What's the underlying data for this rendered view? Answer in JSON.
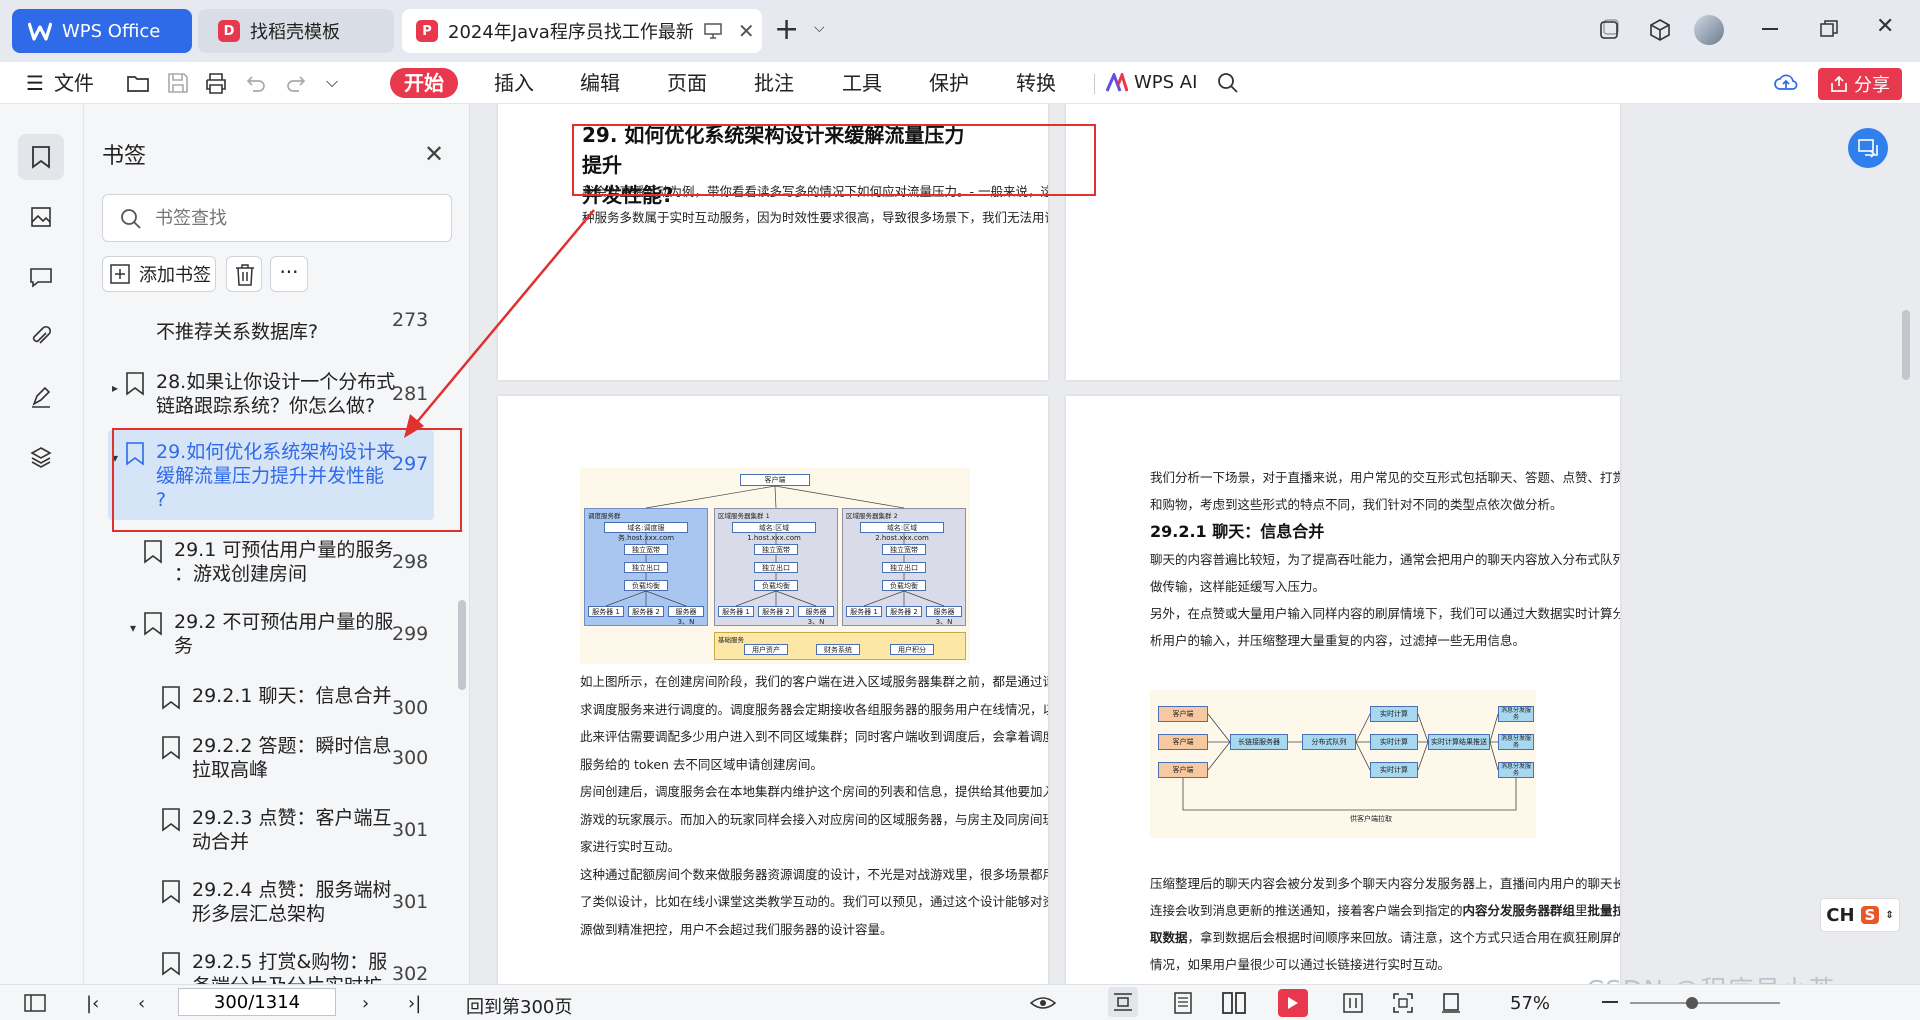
{
  "titlebar": {
    "app_tab": "WPS Office",
    "tabs": [
      {
        "label": "找稻壳模板"
      },
      {
        "label": "2024年Java程序员找工作最新"
      }
    ],
    "new_tab": "+"
  },
  "menubar": {
    "file": "文件",
    "items": [
      "开始",
      "插入",
      "编辑",
      "页面",
      "批注",
      "工具",
      "保护",
      "转换"
    ],
    "wps_ai": "WPS AI",
    "share": "分享"
  },
  "panel": {
    "title": "书签",
    "search_placeholder": "书签查找",
    "add_label": "添加书签",
    "more": "···",
    "items": [
      {
        "label": "不推荐关系数据库?",
        "page": "273"
      },
      {
        "label": "28.如果让你设计一个分布式\n链路跟踪系统？你怎么做?",
        "page": "281"
      },
      {
        "label": "29.如何优化系统架构设计来\n缓解流量压力提升并发性能\n?",
        "page": "297"
      },
      {
        "label": "29.1 可预估用户量的服务\n：游戏创建房间",
        "page": "298"
      },
      {
        "label": "29.2 不可预估用户量的服\n务",
        "page": "299"
      },
      {
        "label": "29.2.1 聊天：信息合并",
        "page": "300"
      },
      {
        "label": "29.2.2 答题：瞬时信息\n拉取高峰",
        "page": "300"
      },
      {
        "label": "29.2.3 点赞：客户端互\n动合并",
        "page": "301"
      },
      {
        "label": "29.2.4 点赞：服务端树\n形多层汇总架构",
        "page": "301"
      },
      {
        "label": "29.2.5 打赏&购物：服\n务端分片及分片实时扩",
        "page": "302"
      }
    ]
  },
  "document": {
    "heading_29": "29.  如何优化系统架构设计来缓解流量压力提升\n并发性能?",
    "p1_line1": "我会以直播互动为例，带你看看读多写多的情况下如何应对流量压力。- 一般来说，这",
    "p1_line2": "种服务多数属于实时互动服务，因为时效性要求很高，导致很多场景下，我们无法用读",
    "diagram_left": {
      "client": "客户端",
      "group1": "调度服务群",
      "group2": "区域服务器集群 1",
      "group3": "区域服务器集群 2",
      "domain1": "域名:调度服务.host.xxx.com",
      "domain2": "域名:区域1.host.xxx.com",
      "domain3": "域名:区域2.host.xxx.com",
      "ingress": "独立宽带",
      "egress": "独立出口",
      "lb": "负载均衡",
      "server1": "服务器 1",
      "server2": "服务器 2",
      "server3n": "服务器 3、N",
      "base": "基础服务",
      "users": "用户资产",
      "finance": "财务系统",
      "points": "用户积分"
    },
    "left_para": [
      "如上图所示，在创建房间阶段，我们的客户端在进入区域服务器集群之前，都是通过请",
      "求调度服务来进行调度的。调度服务器会定期接收各组服务器的服务用户在线情况，以",
      "此来评估需要调配多少用户进入到不同区域集群；同时客户端收到调度后，会拿着调度",
      "服务给的 token 去不同区域申请创建房间。",
      "房间创建后，调度服务会在本地集群内维护这个房间的列表和信息，提供给其他要加入",
      "游戏的玩家展示。而加入的玩家同样会接入对应房间的区域服务器，与房主及同房间玩",
      "家进行实时互动。",
      "这种通过配额房间个数来做服务器资源调度的设计，不光是对战游戏里，很多场景都用",
      "了类似设计，比如在线小课堂这类教学互动的。我们可以预见，通过这个设计能够对资",
      "源做到精准把控，用户不会超过我们服务器的设计容量。"
    ],
    "right_para_top": [
      "我们分析一下场景，对于直播来说，用户常见的交互形式包括聊天、答题、点赞、打赏",
      "和购物，考虑到这些形式的特点不同，我们针对不同的类型点依次做分析。"
    ],
    "heading_2921": "29.2.1  聊天：信息合并",
    "right_para_mid": [
      "聊天的内容普遍比较短，为了提高吞吐能力，通常会把用户的聊天内容放入分布式队列",
      "做传输，这样能延缓写入压力。",
      "另外，在点赞或大量用户输入同样内容的刷屏情境下，我们可以通过大数据实时计算分",
      "析用户的输入，并压缩整理大量重复的内容，过滤掉一些无用信息。"
    ],
    "diagram_right": {
      "client": "客户端",
      "conn": "长链接服务器",
      "queue": "分布式队列",
      "rt": "实时计算",
      "push": "实时计算结果推送",
      "dispatch": "消息分发服务",
      "pull": "供客户端拉取"
    },
    "right_para_bottom": [
      "压缩整理后的聊天内容会被分发到多个聊天内容分发服务器上，直播间内用户的聊天长",
      "连接会收到消息更新的推送通知，接着客户端会到指定的",
      "内容分发服务器群组",
      "里",
      "批量拉",
      "取数据",
      "，拿到数据后会根据时间顺序来回放。请注意，这个方式只适合用在疯狂刷屏的",
      "情况，如果用户量很少可以通过长链接进行实时互动。"
    ]
  },
  "statusbar": {
    "page_value": "300/1314",
    "goto": "回到第300页",
    "zoom": "57%"
  },
  "watermark": "CSDN @程序员小英",
  "ime": "CH",
  "ime_logo": "S",
  "colors": {
    "accent_blue": "#2f6ae8",
    "start_red": "#e8384d",
    "annotation_red": "#e03030",
    "active_bookmark": "#d6e4f8"
  }
}
